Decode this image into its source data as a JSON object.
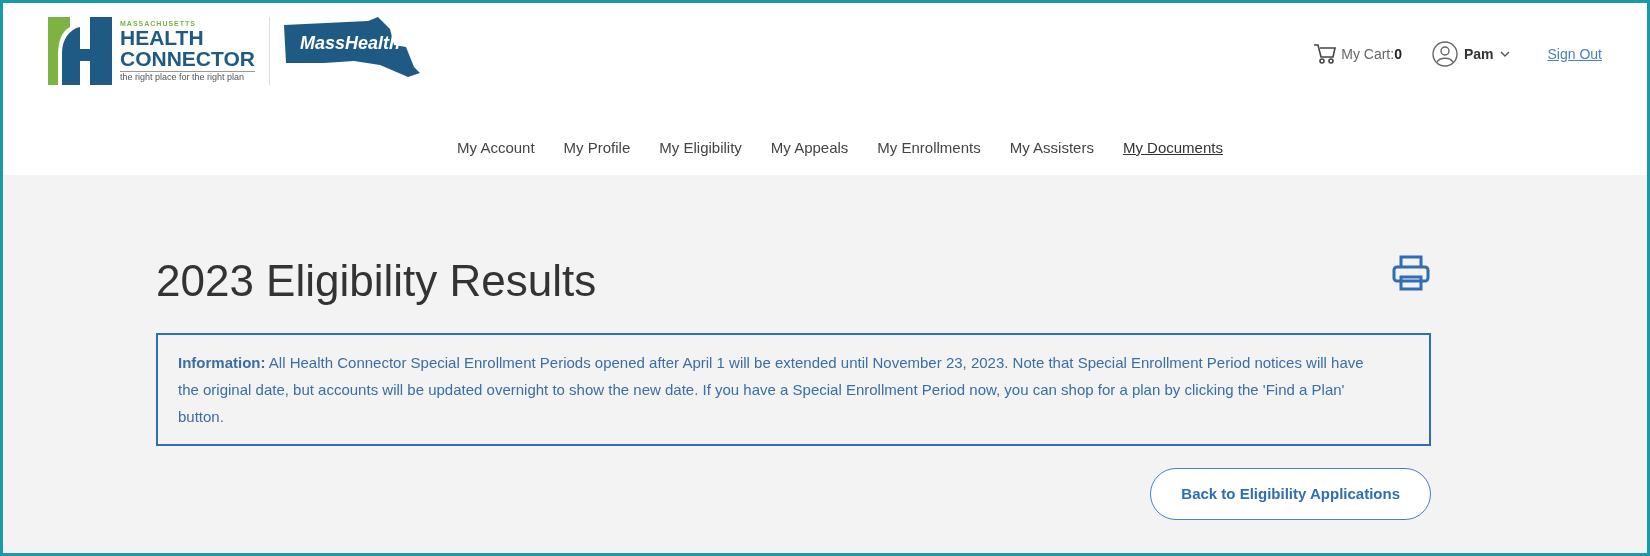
{
  "header": {
    "logo_health_connector": {
      "state": "MASSACHUSETTS",
      "name_line_1": "HEALTH",
      "name_line_2": "CONNECTOR",
      "tagline": "the right place for the right plan"
    },
    "logo_masshealth": "MassHealth",
    "cart": {
      "label": "My Cart:",
      "count": "0"
    },
    "user": "Pam",
    "sign_out": "Sign Out"
  },
  "nav": [
    {
      "label": "My Account",
      "selected": false
    },
    {
      "label": "My Profile",
      "selected": false
    },
    {
      "label": "My Eligibility",
      "selected": false
    },
    {
      "label": "My Appeals",
      "selected": false
    },
    {
      "label": "My Enrollments",
      "selected": false
    },
    {
      "label": "My Assisters",
      "selected": false
    },
    {
      "label": "My Documents",
      "selected": true
    }
  ],
  "page_title": "2023 Eligibility Results",
  "info": "**Information:** All Health Connector Special Enrollment Periods opened after April 1 will be extended until November 23, 2023. Note that Special Enrollment Period notices will have the original date, but accounts will be updated overnight to show the new date. If you have a Special Enrollment Period now, you can shop for a plan by clicking the 'Find a Plan' button.",
  "back_button": "Back to Eligibility Applications"
}
